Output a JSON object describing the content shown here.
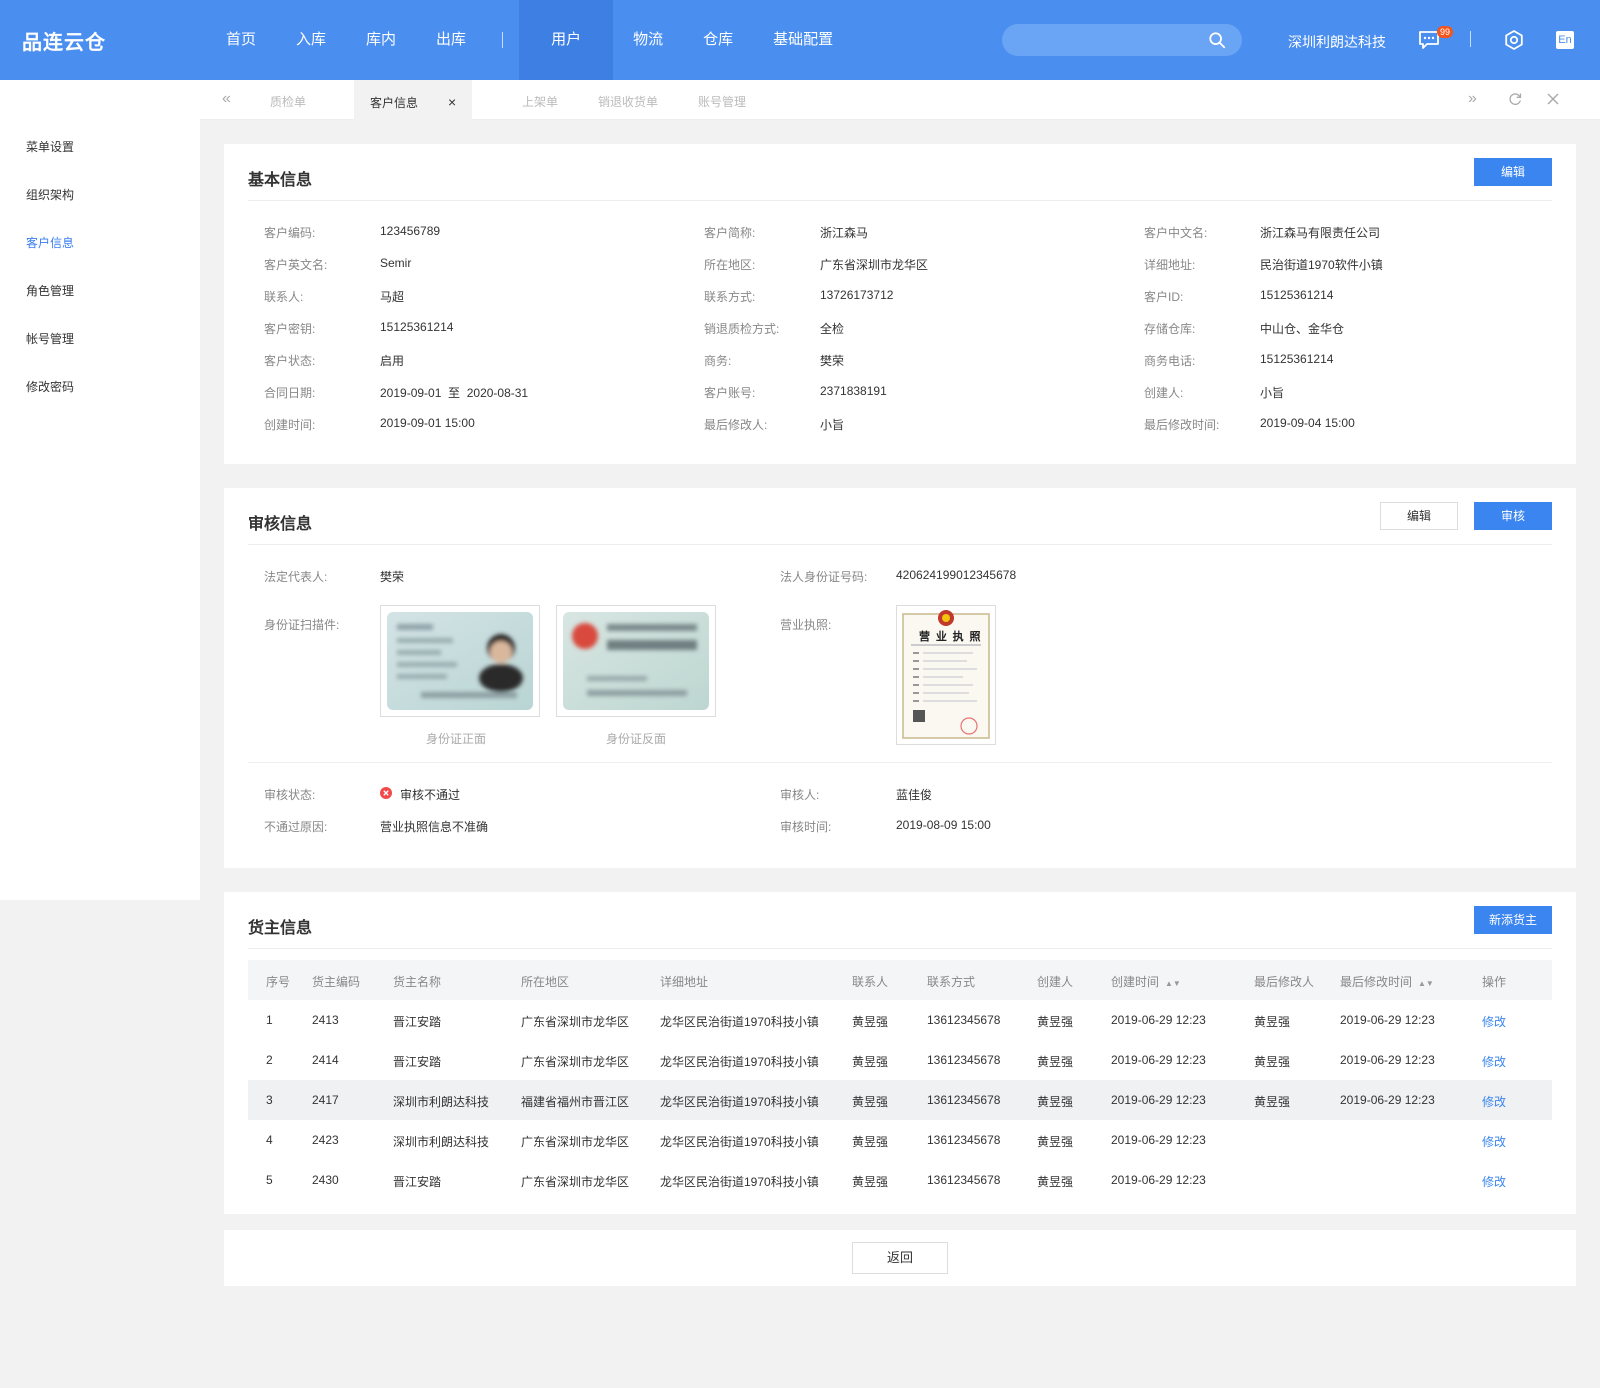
{
  "app": {
    "logo": "品连云仓"
  },
  "nav": [
    "首页",
    "入库",
    "库内",
    "出库",
    "用户",
    "物流",
    "仓库",
    "基础配置"
  ],
  "header": {
    "company": "深圳利朗达科技",
    "badge": "99",
    "lang": "En"
  },
  "sidebar": [
    "菜单设置",
    "组织架构",
    "客户信息",
    "角色管理",
    "帐号管理",
    "修改密码"
  ],
  "tabs": {
    "items": [
      "质检单",
      "客户信息",
      "上架单",
      "销退收货单",
      "账号管理"
    ],
    "close": "×"
  },
  "basic": {
    "title": "基本信息",
    "edit": "编辑",
    "col1": [
      {
        "label": "客户编码:",
        "value": "123456789"
      },
      {
        "label": "客户英文名:",
        "value": "Semir"
      },
      {
        "label": "联系人:",
        "value": "马超"
      },
      {
        "label": "客户密钥:",
        "value": "15125361214"
      },
      {
        "label": "客户状态:",
        "value": "启用"
      },
      {
        "label": "合同日期:",
        "value": "2019-09-01  至  2020-08-31"
      },
      {
        "label": "创建时间:",
        "value": "2019-09-01 15:00"
      }
    ],
    "col2": [
      {
        "label": "客户简称:",
        "value": "浙江森马"
      },
      {
        "label": "所在地区:",
        "value": "广东省深圳市龙华区"
      },
      {
        "label": "联系方式:",
        "value": "13726173712"
      },
      {
        "label": "销退质检方式:",
        "value": "全检"
      },
      {
        "label": "商务:",
        "value": "樊荣"
      },
      {
        "label": "客户账号:",
        "value": "2371838191"
      },
      {
        "label": "最后修改人:",
        "value": "小旨"
      }
    ],
    "col3": [
      {
        "label": "客户中文名:",
        "value": "浙江森马有限责任公司"
      },
      {
        "label": "详细地址:",
        "value": "民治街道1970软件小镇"
      },
      {
        "label": "客户ID:",
        "value": "15125361214"
      },
      {
        "label": "存储仓库:",
        "value": "中山仓、金华仓"
      },
      {
        "label": "商务电话:",
        "value": "15125361214"
      },
      {
        "label": "创建人:",
        "value": "小旨"
      },
      {
        "label": "最后修改时间:",
        "value": "2019-09-04 15:00"
      }
    ]
  },
  "audit": {
    "title": "审核信息",
    "edit": "编辑",
    "audit_btn": "审核",
    "legal_label": "法定代表人:",
    "legal_value": "樊荣",
    "idno_label": "法人身份证号码:",
    "idno_value": "420624199012345678",
    "scan_label": "身份证扫描件:",
    "id_front": "身份证正面",
    "id_back": "身份证反面",
    "license_label": "营业执照:",
    "license_text": "营 业 执 照",
    "status_label": "审核状态:",
    "status_value": "审核不通过",
    "reason_label": "不通过原因:",
    "reason_value": "营业执照信息不准确",
    "auditor_label": "审核人:",
    "auditor_value": "蓝佳俊",
    "time_label": "审核时间:",
    "time_value": "2019-08-09 15:00",
    "status_color": "#f24a4a"
  },
  "owner": {
    "title": "货主信息",
    "add": "新添货主",
    "headers": [
      "序号",
      "货主编码",
      "货主名称",
      "所在地区",
      "详细地址",
      "联系人",
      "联系方式",
      "创建人",
      "创建时间",
      "最后修改人",
      "最后修改时间",
      "操作"
    ],
    "rows": [
      [
        "1",
        "2413",
        "晋江安踏",
        "广东省深圳市龙华区",
        "龙华区民治街道1970科技小镇",
        "黄昱强",
        "13612345678",
        "黄昱强",
        "2019-06-29 12:23",
        "黄昱强",
        "2019-06-29 12:23",
        "修改"
      ],
      [
        "2",
        "2414",
        "晋江安踏",
        "广东省深圳市龙华区",
        "龙华区民治街道1970科技小镇",
        "黄昱强",
        "13612345678",
        "黄昱强",
        "2019-06-29 12:23",
        "黄昱强",
        "2019-06-29 12:23",
        "修改"
      ],
      [
        "3",
        "2417",
        "深圳市利朗达科技",
        "福建省福州市晋江区",
        "龙华区民治街道1970科技小镇",
        "黄昱强",
        "13612345678",
        "黄昱强",
        "2019-06-29 12:23",
        "黄昱强",
        "2019-06-29 12:23",
        "修改"
      ],
      [
        "4",
        "2423",
        "深圳市利朗达科技",
        "广东省深圳市龙华区",
        "龙华区民治街道1970科技小镇",
        "黄昱强",
        "13612345678",
        "黄昱强",
        "2019-06-29 12:23",
        "",
        "",
        "修改"
      ],
      [
        "5",
        "2430",
        "晋江安踏",
        "广东省深圳市龙华区",
        "龙华区民治街道1970科技小镇",
        "黄昱强",
        "13612345678",
        "黄昱强",
        "2019-06-29 12:23",
        "",
        "",
        "修改"
      ]
    ],
    "highlight_row": 3
  },
  "footer": {
    "back": "返回"
  },
  "colors": {
    "primary": "#4a8ef0",
    "button": "#3a85ef",
    "error": "#f24a4a",
    "page_bg": "#f2f2f2"
  }
}
